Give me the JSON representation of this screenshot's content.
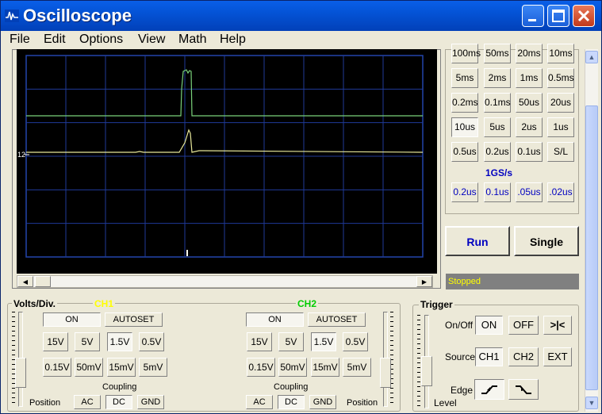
{
  "window": {
    "title": "Oscilloscope"
  },
  "menu": [
    "File",
    "Edit",
    "Options",
    "View",
    "Math",
    "Help"
  ],
  "scope": {
    "marker_label": "12"
  },
  "timebase": {
    "rows": [
      [
        "100ms",
        "50ms",
        "20ms",
        "10ms"
      ],
      [
        "5ms",
        "2ms",
        "1ms",
        "0.5ms"
      ],
      [
        "0.2ms",
        "0.1ms",
        "50us",
        "20us"
      ],
      [
        "10us",
        "5us",
        "2us",
        "1us"
      ],
      [
        "0.5us",
        "0.2us",
        "0.1us",
        "S/L"
      ]
    ],
    "selected": "10us",
    "sample_rate_label": "1GS/s",
    "fast_row": [
      ".2us",
      "0.1us",
      ".05us",
      ".02us"
    ],
    "fast_row_display": [
      "0.2us",
      "0.1us",
      ".05us",
      ".02us"
    ]
  },
  "controls": {
    "run_label": "Run",
    "single_label": "Single",
    "status": "Stopped"
  },
  "volts": {
    "title": "Volts/Div.",
    "ch1_label": "CH1",
    "ch1_color": "#ffff00",
    "ch2_label": "CH2",
    "ch2_color": "#00cc00",
    "on_label": "ON",
    "autoset_label": "AUTOSET",
    "ranges_row1": [
      "15V",
      "5V",
      "1.5V",
      "0.5V"
    ],
    "ranges_row2": [
      "0.15V",
      "50mV",
      "15mV",
      "5mV"
    ],
    "ch1_selected": "1.5V",
    "ch2_selected": "1.5V",
    "coupling_label": "Coupling",
    "coupling": [
      "AC",
      "DC",
      "GND"
    ],
    "coupling_selected": "DC",
    "position_label": "Position"
  },
  "trigger": {
    "title": "Trigger",
    "onoff_label": "On/Off",
    "on": "ON",
    "off": "OFF",
    "sym": ">|<",
    "source_label": "Source",
    "sources": [
      "CH1",
      "CH2",
      "EXT"
    ],
    "source_selected": "CH1",
    "edge_label": "Edge",
    "level_label": "Level"
  }
}
